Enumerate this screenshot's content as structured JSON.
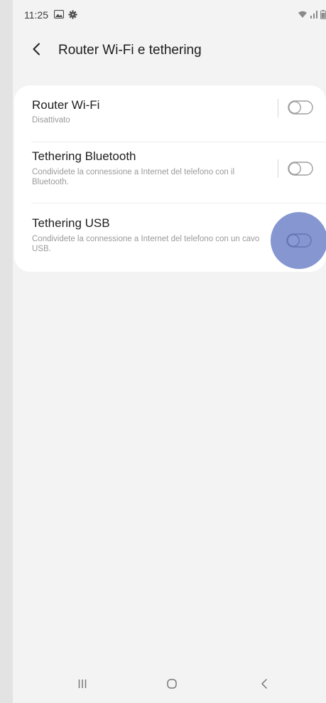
{
  "status_bar": {
    "time": "11:25",
    "left_icons": [
      "gallery-icon",
      "gear-icon"
    ],
    "right_icons": [
      "wifi-icon",
      "signal-icon",
      "battery-icon"
    ]
  },
  "app_bar": {
    "title": "Router Wi-Fi e tethering",
    "back_icon": "chevron-left-icon"
  },
  "settings": [
    {
      "title": "Router Wi-Fi",
      "subtitle": "Disattivato",
      "toggle_on": false
    },
    {
      "title": "Tethering Bluetooth",
      "subtitle": "Condividete la connessione a Internet del telefono con il Bluetooth.",
      "toggle_on": false
    },
    {
      "title": "Tethering USB",
      "subtitle": "Condividete la connessione a Internet del telefono con un cavo USB.",
      "toggle_on": false
    }
  ],
  "nav_bar": {
    "icons": [
      "recents-icon",
      "home-icon",
      "back-icon"
    ]
  },
  "colors": {
    "screen_background": "#f3f3f3",
    "card_background": "#ffffff",
    "touch_indicator": "#7e90cf",
    "toggle_outline": "#9e9e9e"
  }
}
